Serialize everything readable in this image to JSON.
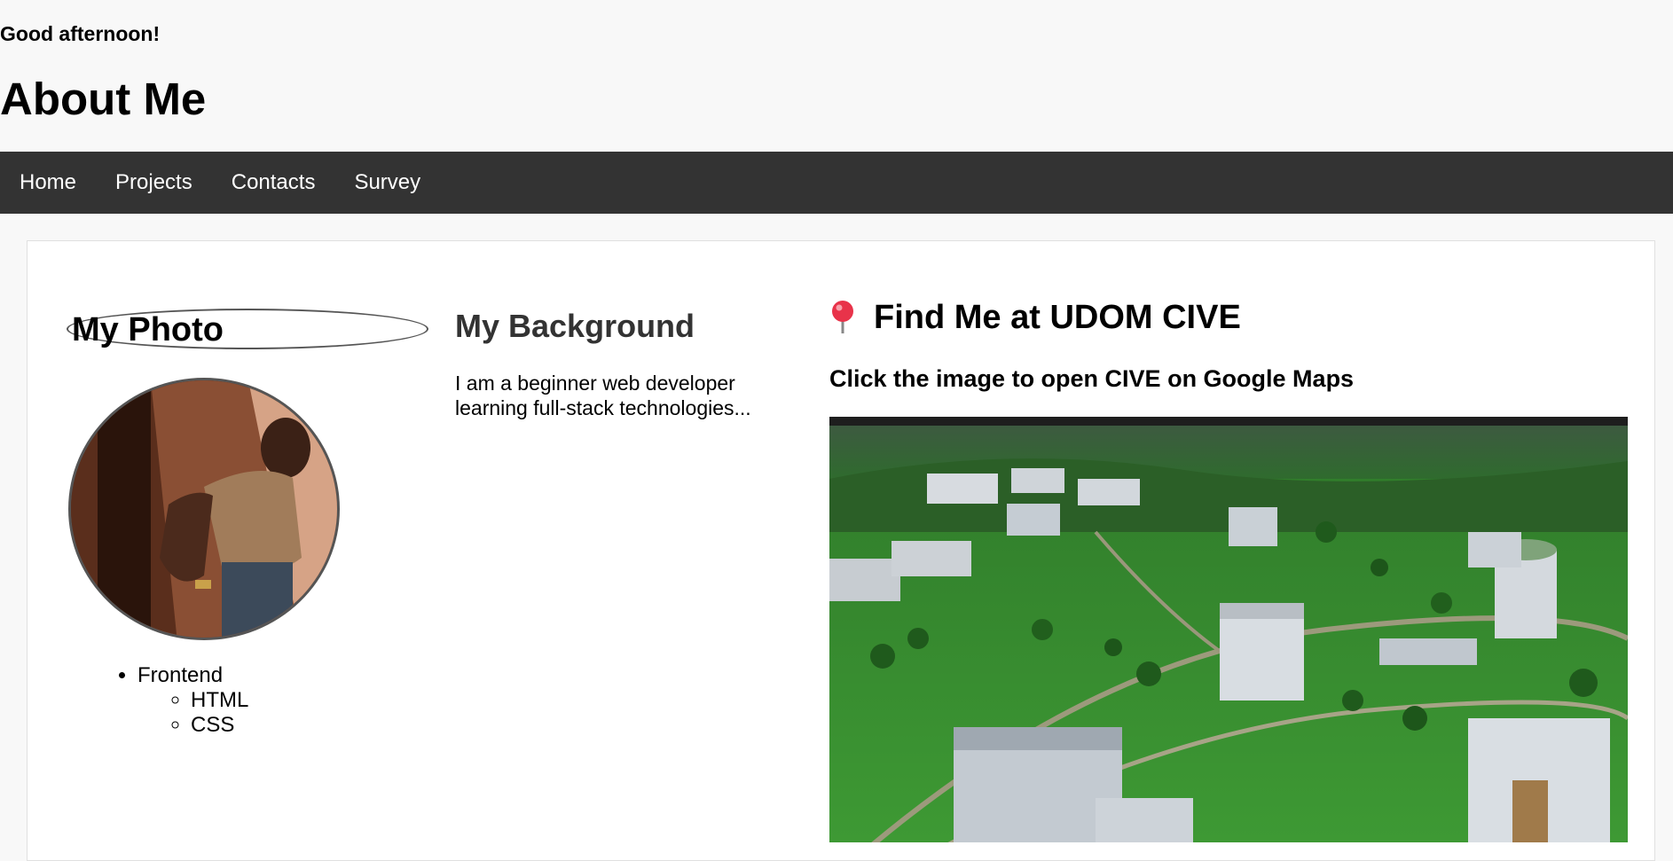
{
  "header": {
    "greeting": "Good afternoon!",
    "title": "About Me"
  },
  "nav": {
    "items": [
      {
        "label": "Home"
      },
      {
        "label": "Projects"
      },
      {
        "label": "Contacts"
      },
      {
        "label": "Survey"
      }
    ]
  },
  "photo_section": {
    "heading": "My Photo",
    "skills": {
      "category": "Frontend",
      "items": [
        "HTML",
        "CSS"
      ]
    }
  },
  "background_section": {
    "heading": "My Background",
    "text": "I am a beginner web developer learning full-stack technologies..."
  },
  "map_section": {
    "pin_icon": "round-pushpin-icon",
    "heading": "Find Me at UDOM CIVE",
    "subheading": "Click the image to open CIVE on Google Maps"
  },
  "colors": {
    "page_background": "#f8f8f8",
    "navbar_background": "#333333",
    "nav_text": "#ffffff",
    "card_background": "#ffffff",
    "pin_red": "#e8334a"
  }
}
